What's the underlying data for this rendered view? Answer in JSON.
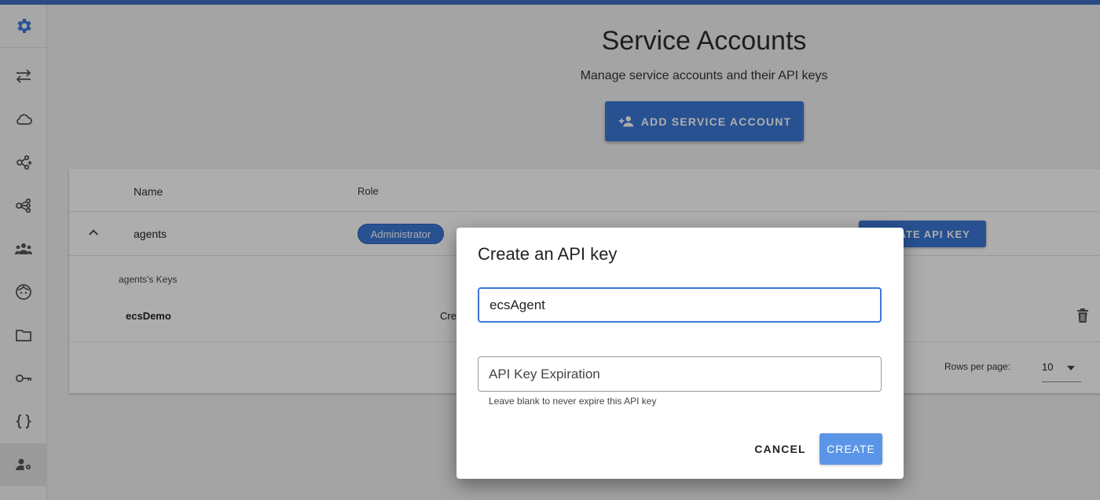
{
  "page": {
    "title": "Service Accounts",
    "subtitle": "Manage service accounts and their API keys",
    "add_button_label": "ADD SERVICE ACCOUNT"
  },
  "sidebar": {
    "items": [
      {
        "icon": "gear-icon",
        "active": false
      },
      {
        "icon": "transfer-arrows-icon",
        "active": false
      },
      {
        "icon": "cloud-icon",
        "active": false
      },
      {
        "icon": "nodes-add-icon",
        "active": false
      },
      {
        "icon": "nodes-icon",
        "active": false
      },
      {
        "icon": "group-icon",
        "active": false
      },
      {
        "icon": "face-icon",
        "active": false
      },
      {
        "icon": "folder-icon",
        "active": false
      },
      {
        "icon": "key-icon",
        "active": false
      },
      {
        "icon": "code-braces-icon",
        "active": false
      },
      {
        "icon": "account-cog-icon",
        "active": true
      }
    ]
  },
  "table": {
    "headers": {
      "name": "Name",
      "role": "Role"
    },
    "row": {
      "name": "agents",
      "role": "Administrator",
      "create_key_label": "CREATE API KEY"
    },
    "keys_label": "agents's Keys",
    "key": {
      "name": "ecsDemo",
      "created_prefix": "Cre"
    },
    "rows_per_page_label": "Rows per page:",
    "rows_per_page_value": "10"
  },
  "dialog": {
    "title": "Create an API key",
    "name_value": "ecsAgent",
    "expiration_placeholder": "API Key Expiration",
    "helper_text": "Leave blank to never expire this API key",
    "cancel_label": "CANCEL",
    "create_label": "CREATE"
  },
  "colors": {
    "accent": "#3b78d8",
    "topbar": "#3f6fc4"
  }
}
